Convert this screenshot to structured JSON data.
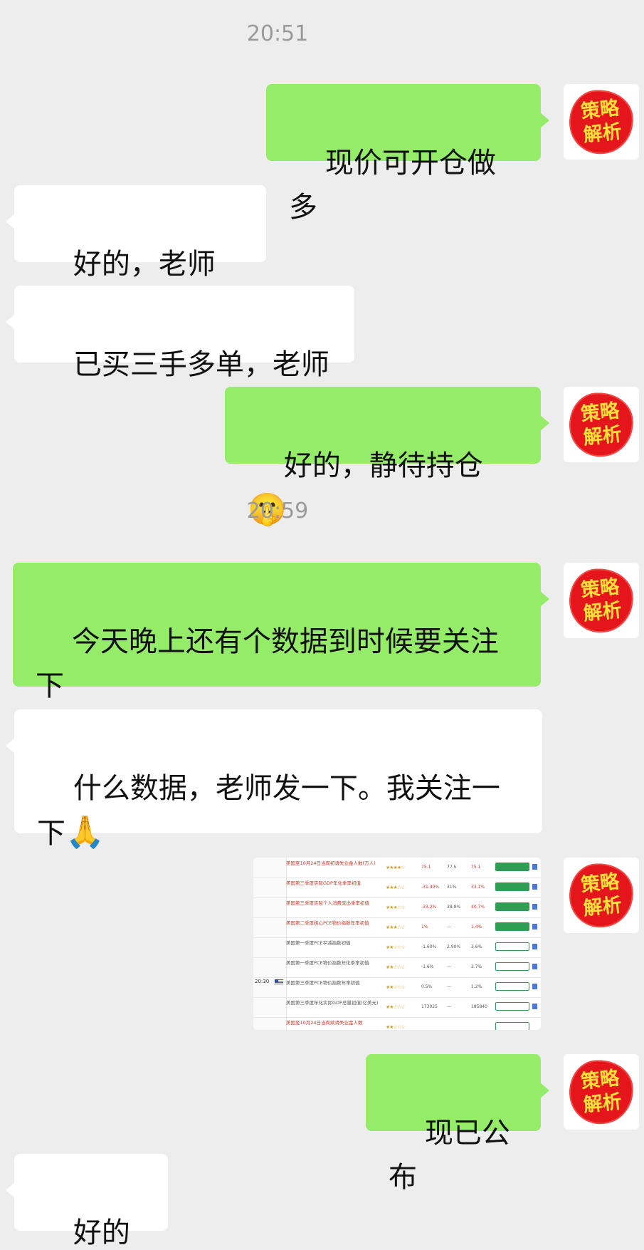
{
  "chat": {
    "timestamps": [
      "20:51",
      "20:59"
    ],
    "avatar_text": [
      "策略",
      "解析"
    ],
    "messages": [
      {
        "text": "现价可开仓做多"
      },
      {
        "text": "好的，老师",
        "emoji": "👌"
      },
      {
        "text": "已买三手多单，老师"
      },
      {
        "text": "好的，静待持仓",
        "emoji": "🤫"
      },
      {
        "text": "今天晚上还有个数据到时候要关注下"
      },
      {
        "text": "什么数据，老师发一下。我关注一下",
        "emoji": "🙏"
      },
      {
        "text": "现已公布"
      },
      {
        "text": "好的",
        "emoji": "🙏"
      }
    ]
  },
  "image_message": {
    "time": "20:30",
    "rows": [
      {
        "title": "美国至10月24日当周初请失业金人数(万人)",
        "v1": "75.1",
        "v2": "77.5",
        "v3": "75.1",
        "highlight": true
      },
      {
        "title": "美国第三季度实际GDP年化季率初值",
        "v1": "-31.40%",
        "v2": "31%",
        "v3": "33.1%",
        "highlight": true
      },
      {
        "title": "美国第三季度实际个人消费支出季率初值",
        "v1": "-33.2%",
        "v2": "38.9%",
        "v3": "40.7%",
        "highlight": true
      },
      {
        "title": "美国第二季度核心PCE物价指数年率初值",
        "v1": "1%",
        "v2": "—",
        "v3": "1.4%",
        "highlight": true
      },
      {
        "title": "美国第一季度PCE平减指数初值",
        "v1": "-1.60%",
        "v2": "2.90%",
        "v3": "3.6%",
        "highlight": false
      },
      {
        "title": "美国第一季度PCE物价指数年化季率初值",
        "v1": "-1.6%",
        "v2": "—",
        "v3": "3.7%",
        "highlight": false
      },
      {
        "title": "美国第三季度PCE物价指数年率初值",
        "v1": "0.5%",
        "v2": "—",
        "v3": "1.2%",
        "highlight": false
      },
      {
        "title": "美国第三季度年化实际GDP总量初值(亿美元)",
        "v1": "173025",
        "v2": "—",
        "v3": "185840",
        "highlight": false
      },
      {
        "title": "美国至10月24日当周续请失业金人数",
        "v1": "",
        "v2": "",
        "v3": "",
        "highlight": true
      }
    ]
  }
}
